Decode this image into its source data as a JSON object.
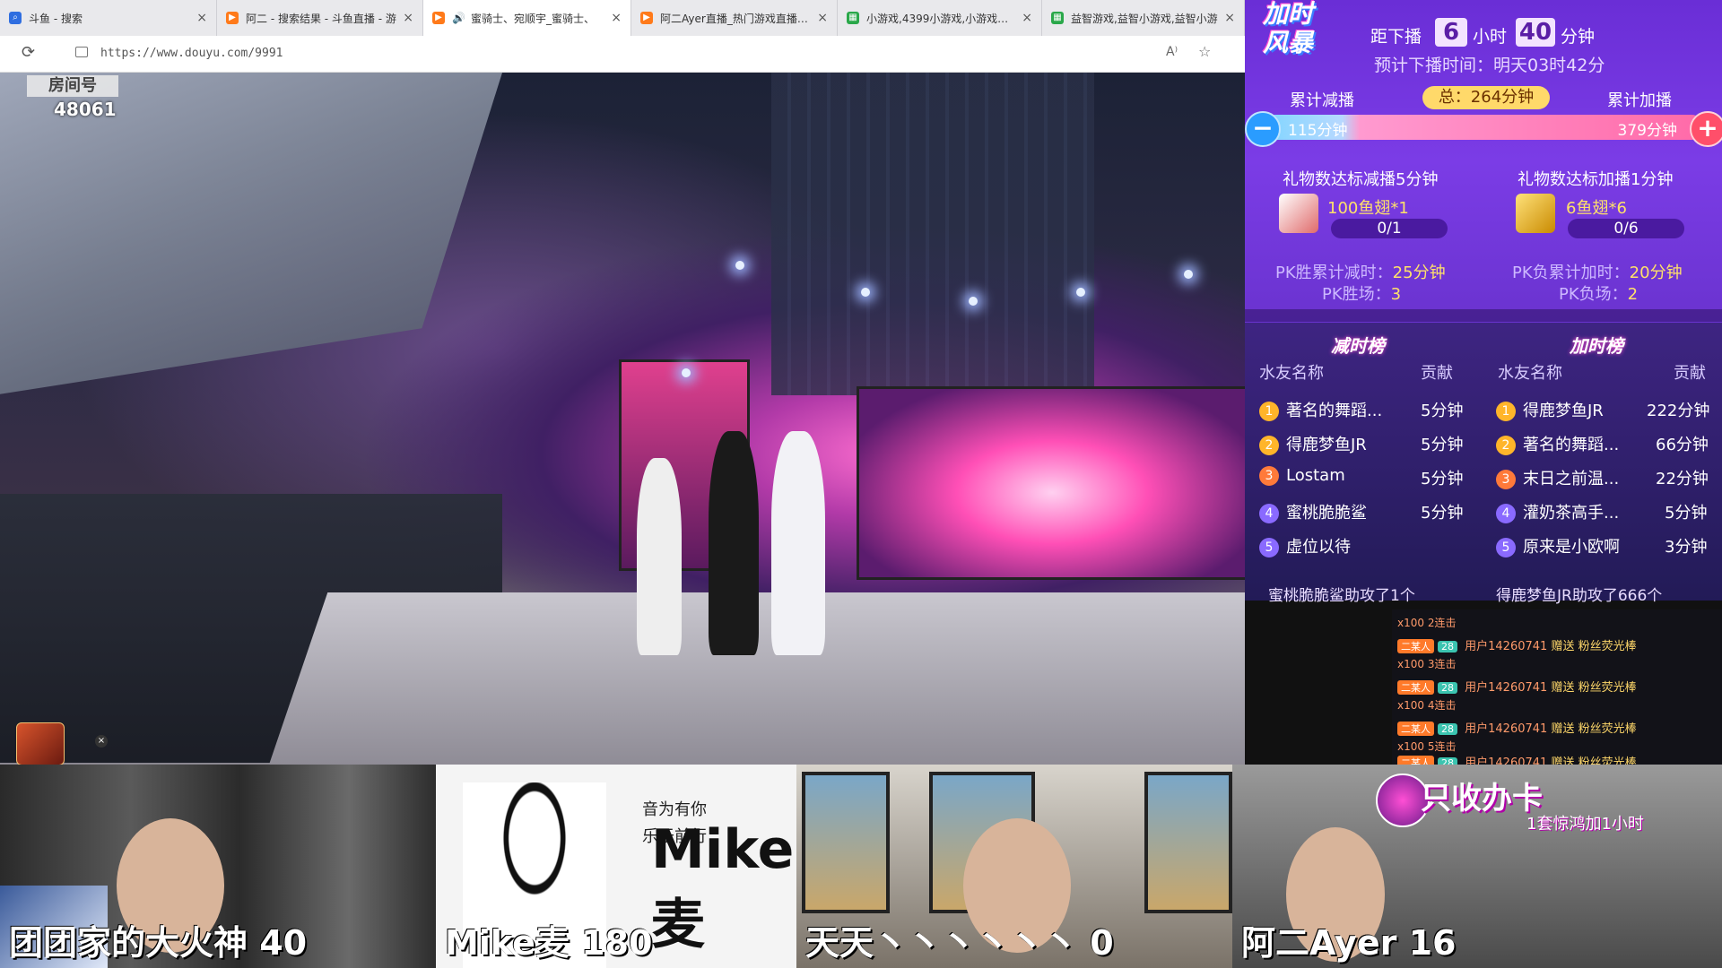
{
  "browser": {
    "tabs": [
      {
        "title": "斗鱼 - 搜索",
        "favicon_color": "#2f6ee0",
        "active": false
      },
      {
        "title": "阿二 - 搜索结果 - 斗鱼直播 - 游",
        "favicon_color": "#ff7a1a",
        "active": false
      },
      {
        "title": "蜜骑士、宛顺宇_蜜骑士、",
        "favicon_color": "#ff7a1a",
        "active": true,
        "audio": true
      },
      {
        "title": "阿二Ayer直播_热门游戏直播_斗",
        "favicon_color": "#ff7a1a",
        "active": false
      },
      {
        "title": "小游戏,4399小游戏,小游戏大全",
        "favicon_color": "#2aa84a",
        "active": false
      },
      {
        "title": "益智游戏,益智小游戏,益智小游",
        "favicon_color": "#2aa84a",
        "active": false
      }
    ],
    "url": "https://www.douyu.com/9991"
  },
  "video": {
    "room_badge": "房间号",
    "room_number": "48061"
  },
  "overlay": {
    "logo_line1": "加时",
    "logo_line2": "风暴",
    "countdown_prefix": "距下播",
    "hours": "6",
    "hours_unit": "小时",
    "minutes": "40",
    "minutes_unit": "分钟",
    "expected": "预计下播时间：明天03时42分",
    "sub_label": "累计减播",
    "add_label": "累计加播",
    "total": "总：264分钟",
    "sub_value": "115分钟",
    "add_value": "379分钟",
    "minus": "−",
    "plus": "+",
    "gift_left_title": "礼物数达标减播5分钟",
    "gift_right_title": "礼物数达标加播1分钟",
    "gift_left_name": "100鱼翅*1",
    "gift_right_name": "6鱼翅*6",
    "gift_left_progress": "0/1",
    "gift_right_progress": "0/6",
    "pk_win_label": "PK胜累计减时：",
    "pk_win_value": "25分钟",
    "pk_win_count_label": "PK胜场：",
    "pk_win_count": "3",
    "pk_lose_label": "PK负累计加时：",
    "pk_lose_value": "20分钟",
    "pk_lose_count_label": "PK负场：",
    "pk_lose_count": "2"
  },
  "boards": {
    "sub_title": "减时榜",
    "add_title": "加时榜",
    "col_name": "水友名称",
    "col_contrib": "贡献",
    "sub_rows": [
      {
        "rank": "1",
        "name": "著名的舞蹈...",
        "value": "5分钟"
      },
      {
        "rank": "2",
        "name": "得鹿梦鱼JR",
        "value": "5分钟"
      },
      {
        "rank": "3",
        "name": "Lostam",
        "value": "5分钟"
      },
      {
        "rank": "4",
        "name": "蜜桃脆脆鲨",
        "value": "5分钟"
      },
      {
        "rank": "5",
        "name": "虚位以待",
        "value": ""
      }
    ],
    "add_rows": [
      {
        "rank": "1",
        "name": "得鹿梦鱼JR",
        "value": "222分钟"
      },
      {
        "rank": "2",
        "name": "著名的舞蹈...",
        "value": "66分钟"
      },
      {
        "rank": "3",
        "name": "末日之前温...",
        "value": "22分钟"
      },
      {
        "rank": "4",
        "name": "灌奶茶高手...",
        "value": "5分钟"
      },
      {
        "rank": "5",
        "name": "原来是小欧啊",
        "value": "3分钟"
      }
    ],
    "assist_left": "蜜桃脆脆鲨助攻了1个",
    "assist_right": "得鹿梦鱼JR助攻了666个"
  },
  "chat": {
    "messages": [
      {
        "badge": "二某人",
        "level": "28",
        "user": "用户14260741",
        "action": "赠送",
        "gift": "粉丝荧光棒",
        "combo": "x100",
        "combo_text": "2连击"
      },
      {
        "badge": "二某人",
        "level": "28",
        "user": "用户14260741",
        "action": "赠送",
        "gift": "粉丝荧光棒",
        "combo": "x100",
        "combo_text": "3连击"
      },
      {
        "badge": "二某人",
        "level": "28",
        "user": "用户14260741",
        "action": "赠送",
        "gift": "粉丝荧光棒",
        "combo": "x100",
        "combo_text": "4连击"
      },
      {
        "badge": "二某人",
        "level": "28",
        "user": "用户14260741",
        "action": "赠送",
        "gift": "粉丝荧光棒",
        "combo": "x100",
        "combo_text": "5连击"
      }
    ]
  },
  "guests": [
    {
      "label": "团团家的大火神  40"
    },
    {
      "label": "Mike麦  180",
      "art_text": "Mike麦",
      "poem_line1": "音为有你",
      "poem_line2": "乐于前行"
    },
    {
      "label": "天天丶丶丶丶丶丶  0"
    },
    {
      "label": "阿二Ayer  16",
      "sign": "只收办卡",
      "sign_sub": "1套惊鸿加1小时"
    }
  ]
}
